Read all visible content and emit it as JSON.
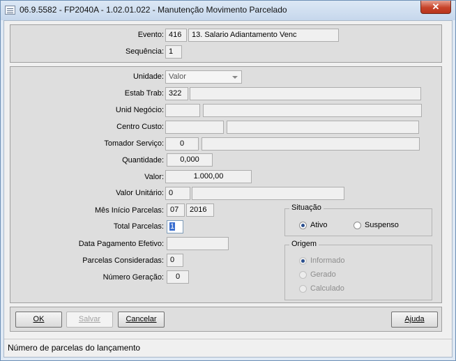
{
  "window": {
    "title": "06.9.5582 - FP2040A - 1.02.01.022 - Manutenção Movimento Parcelado",
    "close_label": "✕"
  },
  "top_panel": {
    "evento_label": "Evento:",
    "evento_code": "416",
    "evento_desc": "13. Salario Adiantamento Venc",
    "sequencia_label": "Sequência:",
    "sequencia_value": "1"
  },
  "form": {
    "unidade_label": "Unidade:",
    "unidade_value": "Valor",
    "estab_label": "Estab Trab:",
    "estab_value": "322",
    "estab_desc": "",
    "unid_negocio_label": "Unid Negócio:",
    "unid_negocio_value": "",
    "unid_negocio_desc": "",
    "centro_custo_label": "Centro Custo:",
    "centro_custo_value": "",
    "centro_custo_desc": "",
    "tomador_label": "Tomador Serviço:",
    "tomador_value": "0",
    "tomador_desc": "",
    "quantidade_label": "Quantidade:",
    "quantidade_value": "0,000",
    "valor_label": "Valor:",
    "valor_value": "1.000,00",
    "valor_unitario_label": "Valor Unitário:",
    "valor_unitario_value": "0",
    "valor_unitario_desc": "",
    "mes_inicio_label": "Mês Início Parcelas:",
    "mes_value": "07",
    "ano_value": "2016",
    "total_parcelas_label": "Total Parcelas:",
    "total_parcelas_value": "1",
    "data_pagamento_label": "Data Pagamento Efetivo:",
    "data_pagamento_value": "",
    "parcelas_consideradas_label": "Parcelas Consideradas:",
    "parcelas_consideradas_value": "0",
    "numero_geracao_label": "Número Geração:",
    "numero_geracao_value": "0"
  },
  "situacao": {
    "title": "Situação",
    "options": [
      "Ativo",
      "Suspenso"
    ],
    "selected": "Ativo"
  },
  "origem": {
    "title": "Origem",
    "options": [
      "Informado",
      "Gerado",
      "Calculado"
    ],
    "selected": "Informado"
  },
  "buttons": {
    "ok_label": "OK",
    "salvar_label": "Salvar",
    "cancelar_label": "Cancelar",
    "ajuda_label": "Ajuda"
  },
  "status_bar": {
    "text": "Número de parcelas do lançamento"
  }
}
